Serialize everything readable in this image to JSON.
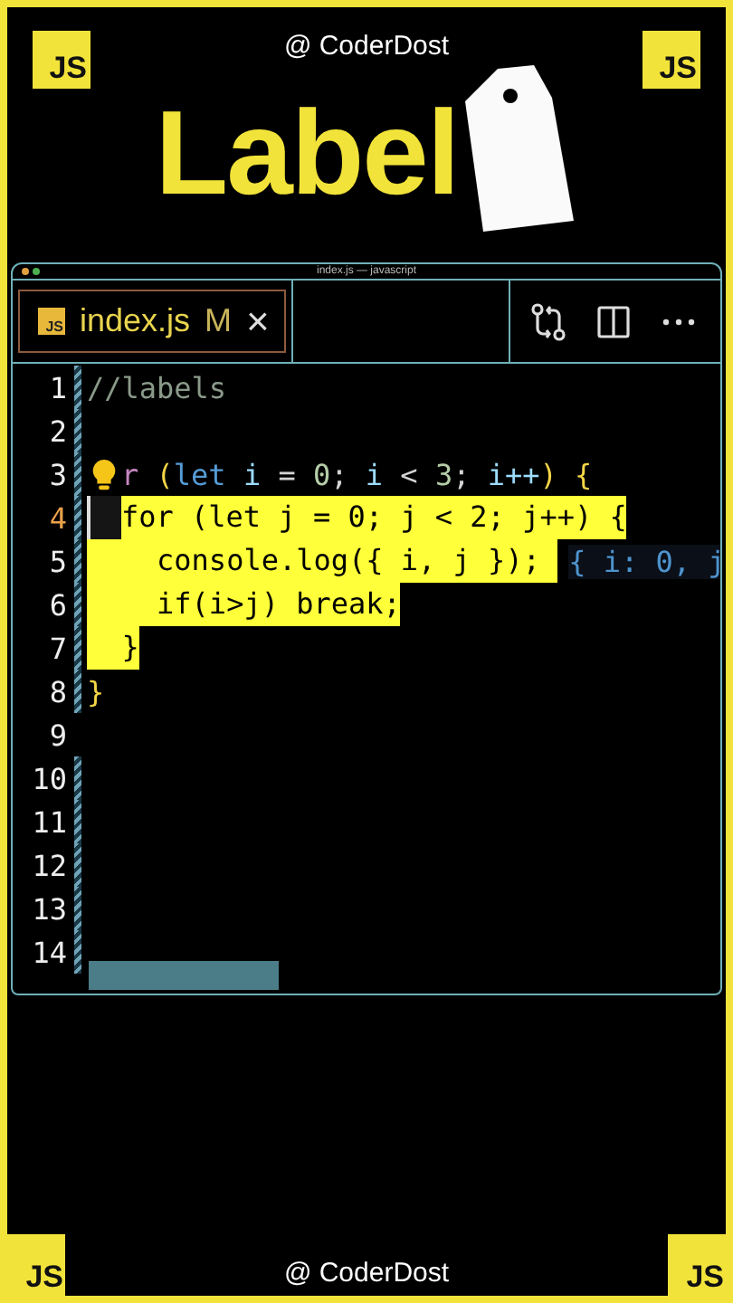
{
  "credit_top": "@ CoderDost",
  "badges_top": [
    "JS",
    "JS"
  ],
  "title": "Label",
  "editor": {
    "window_title": "index.js — javascript",
    "tab": {
      "icon_text": "JS",
      "filename": "index.js",
      "status": "M",
      "close": "×",
      "selected": true
    },
    "lines": [
      {
        "number": "1",
        "modified": true,
        "current": false,
        "segments": [
          {
            "text": "//labels",
            "kind": "comment",
            "selected": false
          }
        ]
      },
      {
        "number": "2",
        "modified": true,
        "current": false
      },
      {
        "number": "3",
        "modified": true,
        "current": false,
        "bulb": true,
        "segments": [
          {
            "text": "r",
            "kind": "control",
            "selected": false
          },
          {
            "text": " (",
            "kind": "bracket",
            "selected": false
          },
          {
            "text": "let",
            "kind": "keyword",
            "selected": false
          },
          {
            "text": " i",
            "kind": "variable",
            "selected": false
          },
          {
            "text": " = ",
            "kind": "plain",
            "selected": false
          },
          {
            "text": "0",
            "kind": "number",
            "selected": false
          },
          {
            "text": ";",
            "kind": "plain",
            "selected": false
          },
          {
            "text": " i",
            "kind": "variable",
            "selected": false
          },
          {
            "text": " < ",
            "kind": "plain",
            "selected": false
          },
          {
            "text": "3",
            "kind": "number",
            "selected": false
          },
          {
            "text": ";",
            "kind": "plain",
            "selected": false
          },
          {
            "text": " i++",
            "kind": "variable",
            "selected": false
          },
          {
            "text": ")",
            "kind": "bracket",
            "selected": false
          },
          {
            "text": " {",
            "kind": "bracket",
            "selected": false
          }
        ]
      },
      {
        "number": "4",
        "modified": true,
        "current": true,
        "segments": [
          {
            "text": "for (let j = 0; j < 2; j++) {",
            "kind": "plain",
            "selected": true
          }
        ]
      },
      {
        "number": "5",
        "modified": true,
        "current": false,
        "hint": "{ i: 0, j",
        "segments": [
          {
            "text": "    console.log({ i, j }); ",
            "kind": "plain",
            "selected": true
          }
        ]
      },
      {
        "number": "6",
        "modified": true,
        "current": false,
        "segments": [
          {
            "text": "    if(i>j) break;",
            "kind": "plain",
            "selected": true
          }
        ]
      },
      {
        "number": "7",
        "modified": true,
        "current": false,
        "segments": [
          {
            "text": "  }",
            "kind": "plain",
            "selected": true
          }
        ]
      },
      {
        "number": "8",
        "modified": true,
        "current": false,
        "segments": [
          {
            "text": "}",
            "kind": "bracket",
            "selected": false
          }
        ]
      },
      {
        "number": "9",
        "modified": false,
        "current": false
      },
      {
        "number": "10",
        "modified": true,
        "current": false
      },
      {
        "number": "11",
        "modified": true,
        "current": false
      },
      {
        "number": "12",
        "modified": true,
        "current": false
      },
      {
        "number": "13",
        "modified": true,
        "current": false
      },
      {
        "number": "14",
        "modified": true,
        "current": false
      }
    ]
  },
  "badges_bottom": [
    "JS",
    "JS"
  ],
  "credit_bottom": "@ CoderDost"
}
